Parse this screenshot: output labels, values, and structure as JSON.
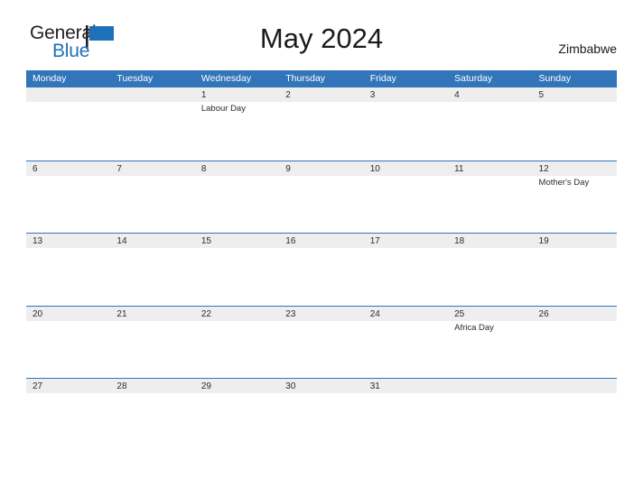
{
  "brand": {
    "name_part1": "General",
    "name_part2": "Blue",
    "flag_icon": "blue-flag-icon",
    "colors": {
      "dark": "#231f20",
      "blue": "#1e71b8"
    }
  },
  "header": {
    "title": "May 2024",
    "region": "Zimbabwe"
  },
  "theme": {
    "header_blue": "#3275ba",
    "row_band_gray": "#eeeeee",
    "text": "#2b2b2b",
    "page_background": "#ffffff"
  },
  "calendar": {
    "month": "May",
    "year": "2024",
    "weekday_headers": [
      "Monday",
      "Tuesday",
      "Wednesday",
      "Thursday",
      "Friday",
      "Saturday",
      "Sunday"
    ],
    "weeks": [
      [
        {
          "day": "",
          "event": ""
        },
        {
          "day": "",
          "event": ""
        },
        {
          "day": "1",
          "event": "Labour Day"
        },
        {
          "day": "2",
          "event": ""
        },
        {
          "day": "3",
          "event": ""
        },
        {
          "day": "4",
          "event": ""
        },
        {
          "day": "5",
          "event": ""
        }
      ],
      [
        {
          "day": "6",
          "event": ""
        },
        {
          "day": "7",
          "event": ""
        },
        {
          "day": "8",
          "event": ""
        },
        {
          "day": "9",
          "event": ""
        },
        {
          "day": "10",
          "event": ""
        },
        {
          "day": "11",
          "event": ""
        },
        {
          "day": "12",
          "event": "Mother's Day"
        }
      ],
      [
        {
          "day": "13",
          "event": ""
        },
        {
          "day": "14",
          "event": ""
        },
        {
          "day": "15",
          "event": ""
        },
        {
          "day": "16",
          "event": ""
        },
        {
          "day": "17",
          "event": ""
        },
        {
          "day": "18",
          "event": ""
        },
        {
          "day": "19",
          "event": ""
        }
      ],
      [
        {
          "day": "20",
          "event": ""
        },
        {
          "day": "21",
          "event": ""
        },
        {
          "day": "22",
          "event": ""
        },
        {
          "day": "23",
          "event": ""
        },
        {
          "day": "24",
          "event": ""
        },
        {
          "day": "25",
          "event": "Africa Day"
        },
        {
          "day": "26",
          "event": ""
        }
      ],
      [
        {
          "day": "27",
          "event": ""
        },
        {
          "day": "28",
          "event": ""
        },
        {
          "day": "29",
          "event": ""
        },
        {
          "day": "30",
          "event": ""
        },
        {
          "day": "31",
          "event": ""
        },
        {
          "day": "",
          "event": ""
        },
        {
          "day": "",
          "event": ""
        }
      ]
    ]
  }
}
